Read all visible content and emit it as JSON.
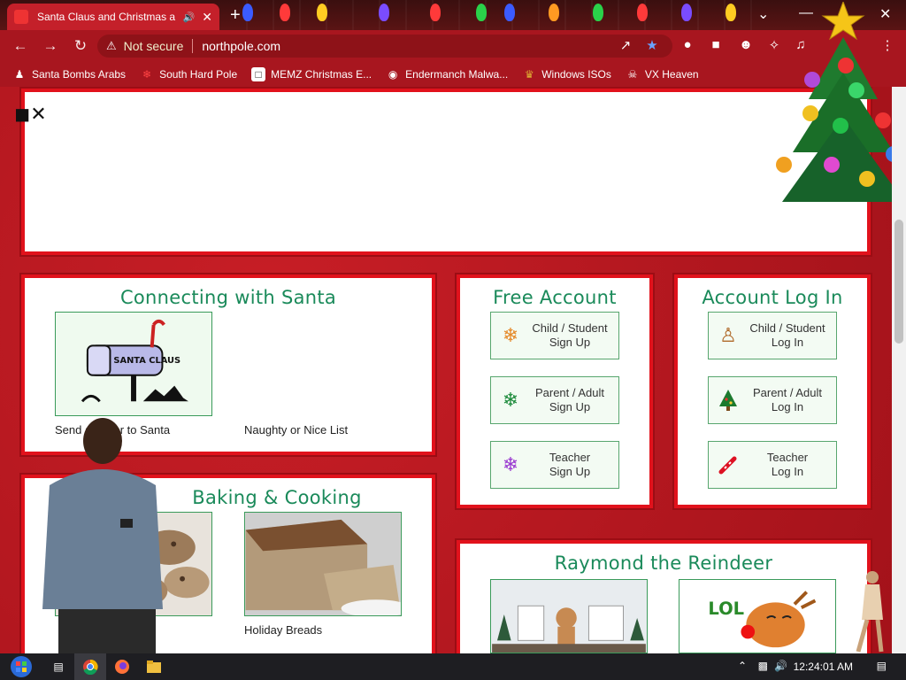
{
  "browser": {
    "tab_title": "Santa Claus and Christmas a",
    "address_warning": "Not secure",
    "url": "northpole.com"
  },
  "bookmarks": [
    {
      "label": "Santa Bombs Arabs",
      "icon": "figure-icon"
    },
    {
      "label": "South Hard Pole",
      "icon": "snowflake-icon"
    },
    {
      "label": "MEMZ Christmas E...",
      "icon": "page-icon"
    },
    {
      "label": "Endermanch Malwa...",
      "icon": "cat-icon"
    },
    {
      "label": "Windows ISOs",
      "icon": "trophy-icon"
    },
    {
      "label": "VX Heaven",
      "icon": "skull-icon"
    }
  ],
  "sections": {
    "connecting": {
      "title": "Connecting with Santa",
      "captions": [
        "Send a Letter to Santa",
        "Naughty or Nice List"
      ],
      "mailbox_text": "SANTA CLAUS"
    },
    "baking": {
      "title": "Baking & Cooking",
      "captions": [
        "",
        "Holiday Breads"
      ]
    },
    "free_account": {
      "title": "Free Account",
      "buttons": [
        {
          "line1": "Child / Student",
          "line2": "Sign Up",
          "icon": "snowflake-orange-icon"
        },
        {
          "line1": "Parent / Adult",
          "line2": "Sign Up",
          "icon": "snowflake-green-icon"
        },
        {
          "line1": "Teacher",
          "line2": "Sign Up",
          "icon": "snowflake-purple-icon"
        }
      ]
    },
    "login": {
      "title": "Account Log In",
      "buttons": [
        {
          "line1": "Child / Student",
          "line2": "Log In",
          "icon": "gingerbread-icon"
        },
        {
          "line1": "Parent / Adult",
          "line2": "Log In",
          "icon": "tree-icon"
        },
        {
          "line1": "Teacher",
          "line2": "Log In",
          "icon": "candy-cane-icon"
        }
      ]
    },
    "raymond": {
      "title": "Raymond the Reindeer",
      "lol_text": "LOL"
    }
  },
  "taskbar": {
    "clock": "12:24:01 AM"
  },
  "colors": {
    "accent_green": "#1a8a5a",
    "border_red": "#e1121c"
  }
}
